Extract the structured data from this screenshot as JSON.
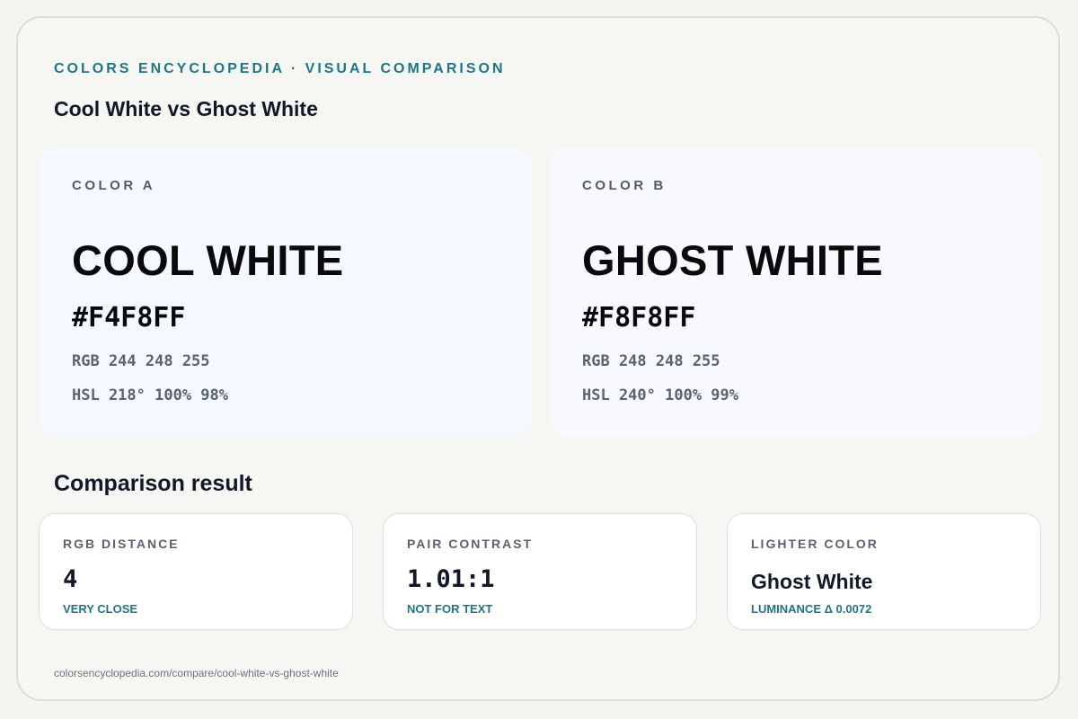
{
  "header": {
    "eyebrow": "COLORS ENCYCLOPEDIA · VISUAL COMPARISON",
    "title": "Cool White vs Ghost White"
  },
  "colors": [
    {
      "label": "COLOR A",
      "name": "COOL WHITE",
      "hex": "#F4F8FF",
      "rgb": "RGB 244 248 255",
      "hsl": "HSL 218° 100% 98%",
      "swatch_color": "#F4F8FF"
    },
    {
      "label": "COLOR B",
      "name": "GHOST WHITE",
      "hex": "#F8F8FF",
      "rgb": "RGB 248 248 255",
      "hsl": "HSL 240° 100% 99%",
      "swatch_color": "#F8F8FF"
    }
  ],
  "comparison": {
    "title": "Comparison result",
    "cards": [
      {
        "title": "RGB DISTANCE",
        "value": "4",
        "note": "VERY CLOSE"
      },
      {
        "title": "PAIR CONTRAST",
        "value": "1.01:1",
        "note": "NOT FOR TEXT"
      },
      {
        "title": "LIGHTER COLOR",
        "value": "Ghost White",
        "note": "LUMINANCE Δ 0.0072"
      }
    ]
  },
  "footer": {
    "url": "colorsencyclopedia.com/compare/cool-white-vs-ghost-white"
  },
  "theme": {
    "accent": "#1F7585",
    "page_background": "#F6F6F2",
    "card_background": "#FFFFFF"
  }
}
